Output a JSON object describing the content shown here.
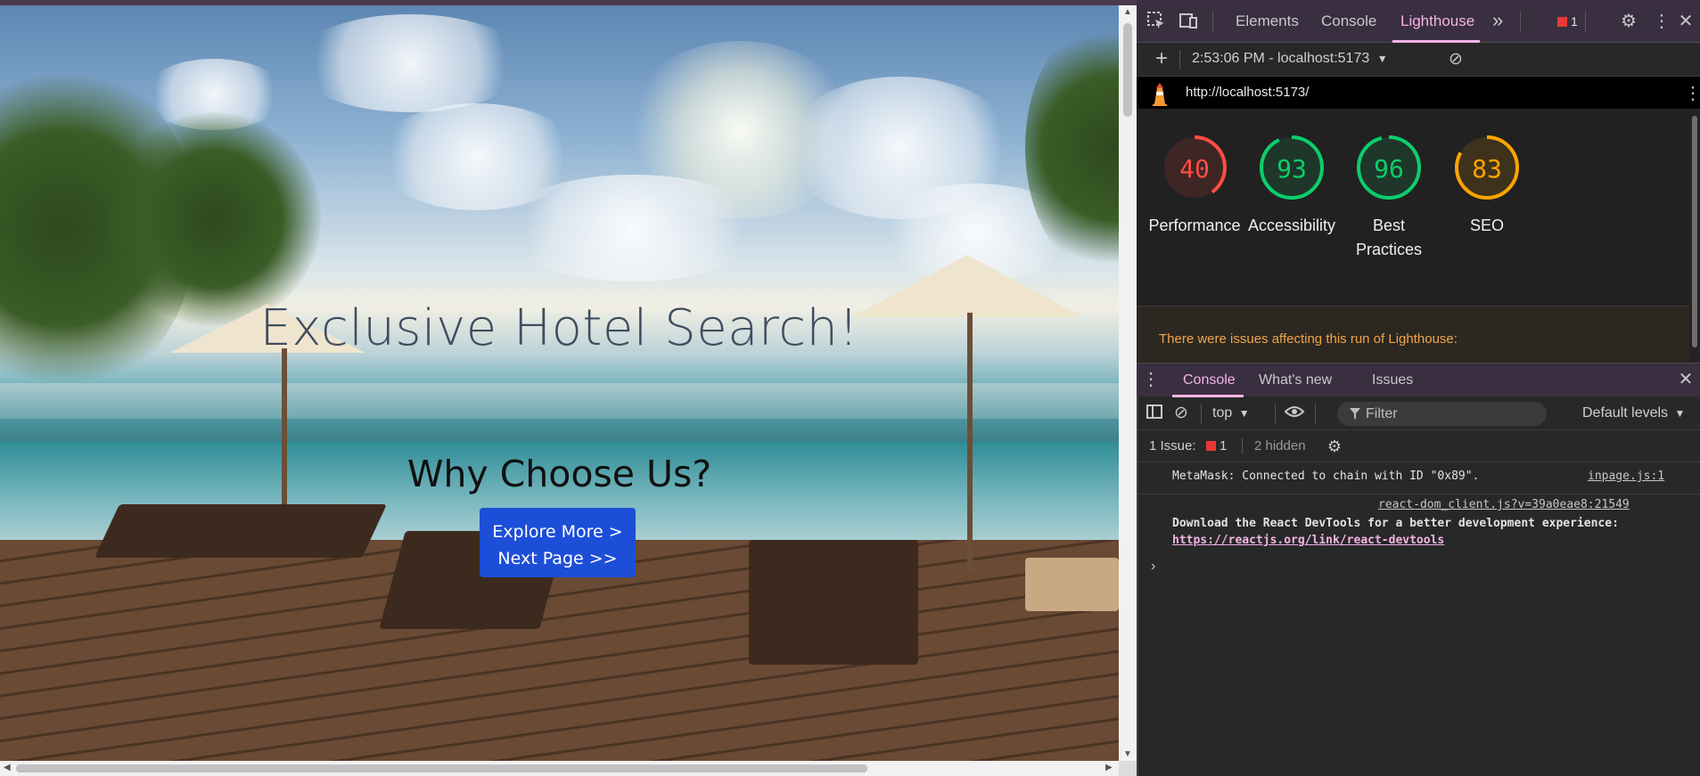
{
  "page": {
    "hero_title": "Exclusive Hotel Search!",
    "hero_subtitle": "Why Choose Us?",
    "cta_line1": "Explore More >",
    "cta_line2": "Next Page >>"
  },
  "devtools": {
    "tabs": [
      {
        "label": "Elements"
      },
      {
        "label": "Console"
      },
      {
        "label": "Lighthouse"
      }
    ],
    "more_tabs": "»",
    "issues_badge_count": "1",
    "report_selector": "2:53:06 PM - localhost:5173",
    "url": "http://localhost:5173/",
    "scores": [
      {
        "value": "40",
        "label": "Performance",
        "color": "#ff4e42",
        "fraction": 0.4
      },
      {
        "value": "93",
        "label": "Accessibility",
        "color": "#0cce6b",
        "fraction": 0.93
      },
      {
        "value": "96",
        "label": "Best Practices",
        "color": "#0cce6b",
        "fraction": 0.96
      },
      {
        "value": "83",
        "label": "SEO",
        "color": "#ffa400",
        "fraction": 0.83
      }
    ],
    "warning": "There were issues affecting this run of Lighthouse:",
    "drawer_tabs": [
      {
        "label": "Console"
      },
      {
        "label": "What's new"
      },
      {
        "label": "Issues"
      }
    ],
    "context": "top",
    "filter_placeholder": "Filter",
    "levels": "Default levels",
    "issues_label": "1 Issue:",
    "issues_count": "1",
    "hidden_label": "2 hidden",
    "messages": [
      {
        "text": "MetaMask: Connected to chain with ID \"0x89\".",
        "source": "inpage.js:1"
      },
      {
        "source": "react-dom_client.js?v=39a0eae8:21549",
        "text": "Download the React DevTools for a better development experience:",
        "link": "https://reactjs.org/link/react-devtools"
      }
    ],
    "prompt": "›"
  },
  "colors": {
    "accent": "#f5b3e6",
    "cta_bg": "#1d4ed8",
    "warning": "#f2a54a"
  }
}
